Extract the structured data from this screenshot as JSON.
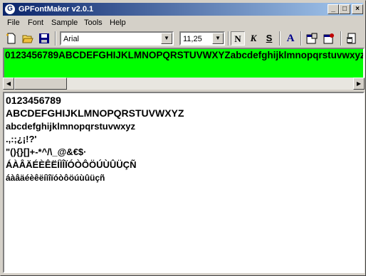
{
  "window": {
    "title": "GPFontMaker v2.0.1"
  },
  "menu": [
    {
      "label": "File",
      "key": "F",
      "rest": "ile"
    },
    {
      "label": "Font",
      "key": "o",
      "pre": "F",
      "rest": "nt"
    },
    {
      "label": "Sample",
      "key": "S",
      "rest": "ample"
    },
    {
      "label": "Tools",
      "key": "T",
      "rest": "ools"
    },
    {
      "label": "Help",
      "key": "H",
      "rest": "elp"
    }
  ],
  "toolbar": {
    "font_name": "Arial",
    "font_size": "11,25",
    "bold_glyph": "N",
    "italic_glyph": "K",
    "strike_glyph": "S",
    "color_glyph": "A"
  },
  "preview": {
    "text": "0123456789ABCDEFGHIJKLMNOPQRSTUVWXYZabcdefghijklmnopqrstuvwxyz",
    "bg_color": "#00ff00"
  },
  "sample_lines": [
    "0123456789",
    "ABCDEFGHIJKLMNOPQRSTUVWXYZ",
    "abcdefghijklmnopqrstuvwxyz",
    ".,:;¿¡!?'",
    "\"(){}[]+-*^/\\_@&€$·",
    "ÁÀÂÄÉÈÊËÍÌÎÏÓÒÔÖÚÙÛÜÇÑ",
    "áàâäéèêëíìîïóòôöúùûüçñ"
  ],
  "icons": {
    "new": "new-file-icon",
    "open": "open-folder-icon",
    "save": "save-disk-icon",
    "props1": "properties-icon",
    "props2": "settings-icon",
    "export": "export-icon"
  }
}
